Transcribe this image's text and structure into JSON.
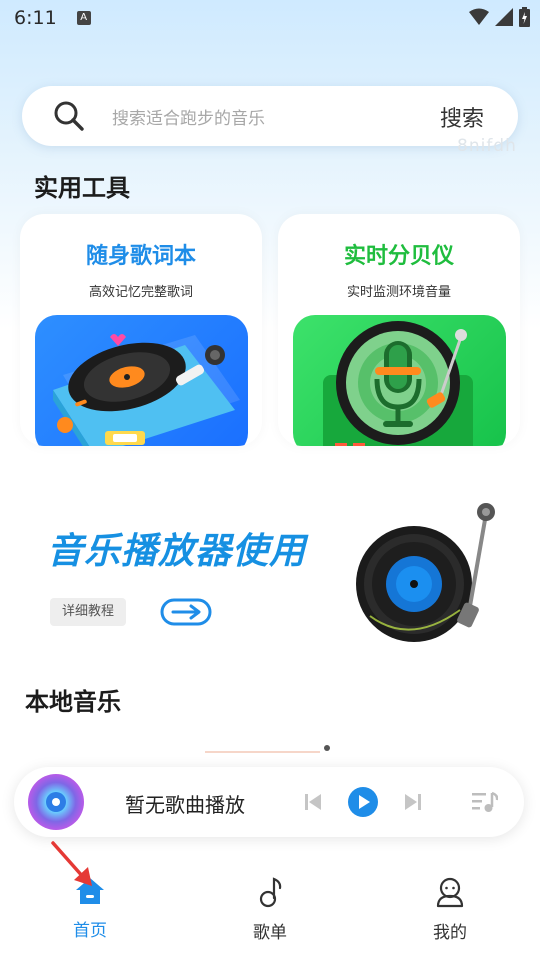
{
  "status_bar": {
    "time": "6:11",
    "notification_badge": "A"
  },
  "search": {
    "placeholder": "搜索适合跑步的音乐",
    "button_label": "搜索"
  },
  "watermark": "8nifdh",
  "tools_section": {
    "title": "实用工具",
    "cards": [
      {
        "title": "随身歌词本",
        "subtitle": "高效记忆完整歌词",
        "accent": "#1f8de8"
      },
      {
        "title": "实时分贝仪",
        "subtitle": "实时监测环境音量",
        "accent": "#1fbd3e"
      }
    ]
  },
  "banner": {
    "title": "音乐播放器使用",
    "button_label": "详细教程"
  },
  "local_section": {
    "title": "本地音乐"
  },
  "player": {
    "status": "暂无歌曲播放"
  },
  "tabbar": {
    "tabs": [
      {
        "label": "首页",
        "icon": "home-icon",
        "active": true
      },
      {
        "label": "歌单",
        "icon": "music-note-icon",
        "active": false
      },
      {
        "label": "我的",
        "icon": "user-icon",
        "active": false
      }
    ]
  },
  "colors": {
    "primary_blue": "#1f8de8",
    "green": "#1fbd3e",
    "annotation_red": "#e53935"
  }
}
